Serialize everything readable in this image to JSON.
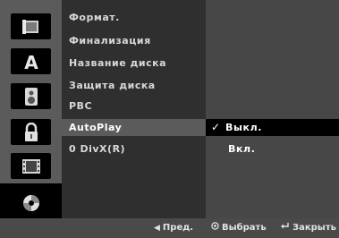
{
  "sidebar": {
    "icons": [
      "disc-settings-icon",
      "language-icon",
      "audio-icon",
      "lock-icon",
      "film-icon",
      "disc-icon"
    ],
    "active": "disc-icon"
  },
  "menu": {
    "items": [
      {
        "label": "Формат."
      },
      {
        "label": "Финализация"
      },
      {
        "label": "Название диска"
      },
      {
        "label": "Защита диска"
      },
      {
        "label": "PBC"
      },
      {
        "label": "AutoPlay"
      },
      {
        "label": "0 DivX(R)"
      }
    ],
    "selected_index": 5
  },
  "options": {
    "items": [
      {
        "label": "Выкл.",
        "checked": true
      },
      {
        "label": "Вкл.",
        "checked": false
      }
    ],
    "check_glyph": "✓"
  },
  "footer": {
    "prev": {
      "icon": "left-arrow-icon",
      "label": "Пред."
    },
    "select": {
      "icon": "select-button-icon",
      "label": "Выбрать"
    },
    "close": {
      "icon": "return-icon",
      "label": "Закрыть"
    }
  },
  "colors": {
    "sidebar_bg": "#5b5b5b",
    "menu_bg": "#2f2f2f",
    "options_bg": "#474747",
    "highlight_menu": "#5b5b5b",
    "highlight_option": "#000000"
  }
}
